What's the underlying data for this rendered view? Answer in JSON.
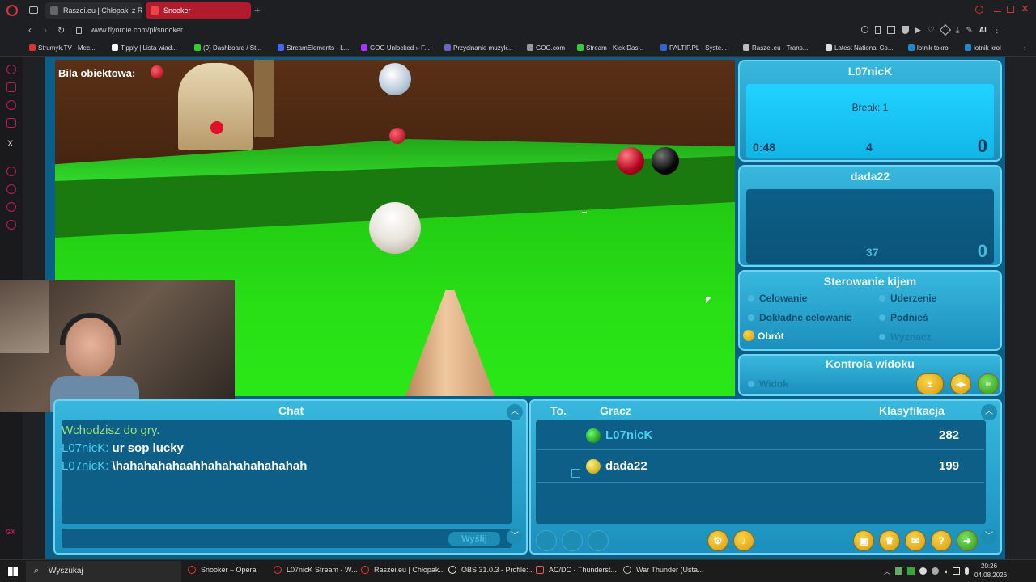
{
  "browser": {
    "tabs": [
      {
        "label": "Raszei.eu | Chłopaki z Ras",
        "active": false
      },
      {
        "label": "Snooker",
        "active": true
      }
    ],
    "url": "www.flyordie.com/pl/snooker",
    "ai_label": "AI",
    "bookmarks": [
      "Strumyk.TV - Mec...",
      "Tipply | Lista wiad...",
      "(9) Dashboard / St...",
      "StreamElements - L...",
      "GOG Unlocked » F...",
      "Przycinanie muzyk...",
      "GOG.com",
      "Stream - Kick Das...",
      "PALTIP.PL - Syste...",
      "Raszei.eu - Trans...",
      "Latest National Co...",
      "lotnik tokrol",
      "lotnik krol"
    ]
  },
  "game": {
    "object_ball_label": "Bila obiektowa:",
    "player1": {
      "name": "L07nicK",
      "break_text": "Break: 1",
      "timer": "0:48",
      "count": "4",
      "score": "0"
    },
    "player2": {
      "name": "dada22",
      "count": "37",
      "score": "0"
    },
    "cue_control": {
      "title": "Sterowanie kijem",
      "options": [
        "Celowanie",
        "Uderzenie",
        "Dokładne celowanie",
        "Podnieś",
        "Obrót",
        "Wyznacz"
      ],
      "selected": "Obrót"
    },
    "view_control": {
      "title": "Kontrola widoku",
      "option": "Widok"
    },
    "chat": {
      "title": "Chat",
      "system_msg": "Wchodzisz do gry.",
      "messages": [
        {
          "user": "L07nicK:",
          "text": " ur sop lucky"
        },
        {
          "user": "L07nicK:",
          "text": " \\hahahahahaahhahahahahahahah"
        }
      ],
      "send_label": "Wyślij"
    },
    "ranking": {
      "col_to": "To.",
      "col_player": "Gracz",
      "col_rating": "Klasyfikacja",
      "rows": [
        {
          "name": "L07nicK",
          "rating": "282",
          "ball_color": "#1a8a1a"
        },
        {
          "name": "dada22",
          "rating": "199",
          "ball_color": "#d8c400"
        }
      ]
    }
  },
  "taskbar": {
    "search": "Wyszukaj",
    "items": [
      "Snooker – Opera",
      "L07nicK Stream - W...",
      "Raszei.eu | Chłopak...",
      "OBS 31.0.3 - Profile:...",
      "AC/DC - Thunderst...",
      "War Thunder (Usta..."
    ],
    "time": "20:26",
    "date": "04.08.2026"
  }
}
